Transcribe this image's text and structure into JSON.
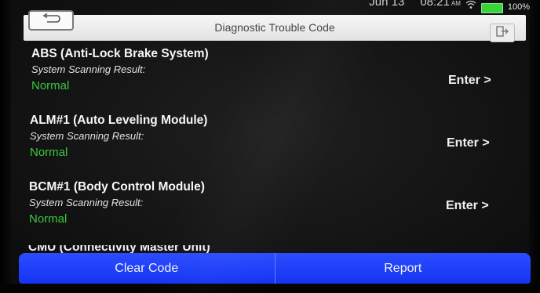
{
  "status_bar": {
    "date": "Jun 13",
    "time": "08:21",
    "ampm": "AM",
    "wifi_icon": "wifi-icon",
    "battery_percent": "100%",
    "battery_color": "#37d43a"
  },
  "header": {
    "title": "Diagnostic Trouble Code",
    "back_icon": "back-arrow-icon",
    "exit_icon": "exit-icon"
  },
  "systems": [
    {
      "name": "ABS (Anti-Lock Brake System)",
      "result_label": "System Scanning Result:",
      "result": "Normal",
      "enter_label": "Enter >"
    },
    {
      "name": "ALM#1 (Auto Leveling Module)",
      "result_label": "System Scanning Result:",
      "result": "Normal",
      "enter_label": "Enter >"
    },
    {
      "name": "BCM#1 (Body Control Module)",
      "result_label": "System Scanning Result:",
      "result": "Normal",
      "enter_label": "Enter >"
    },
    {
      "name": "CMU (Connectivity Master Unit)"
    }
  ],
  "footer": {
    "clear_code_label": "Clear Code",
    "report_label": "Report",
    "accent_color": "#1f3ff8"
  },
  "colors": {
    "normal_status": "#39c83c",
    "background": "#151516"
  }
}
